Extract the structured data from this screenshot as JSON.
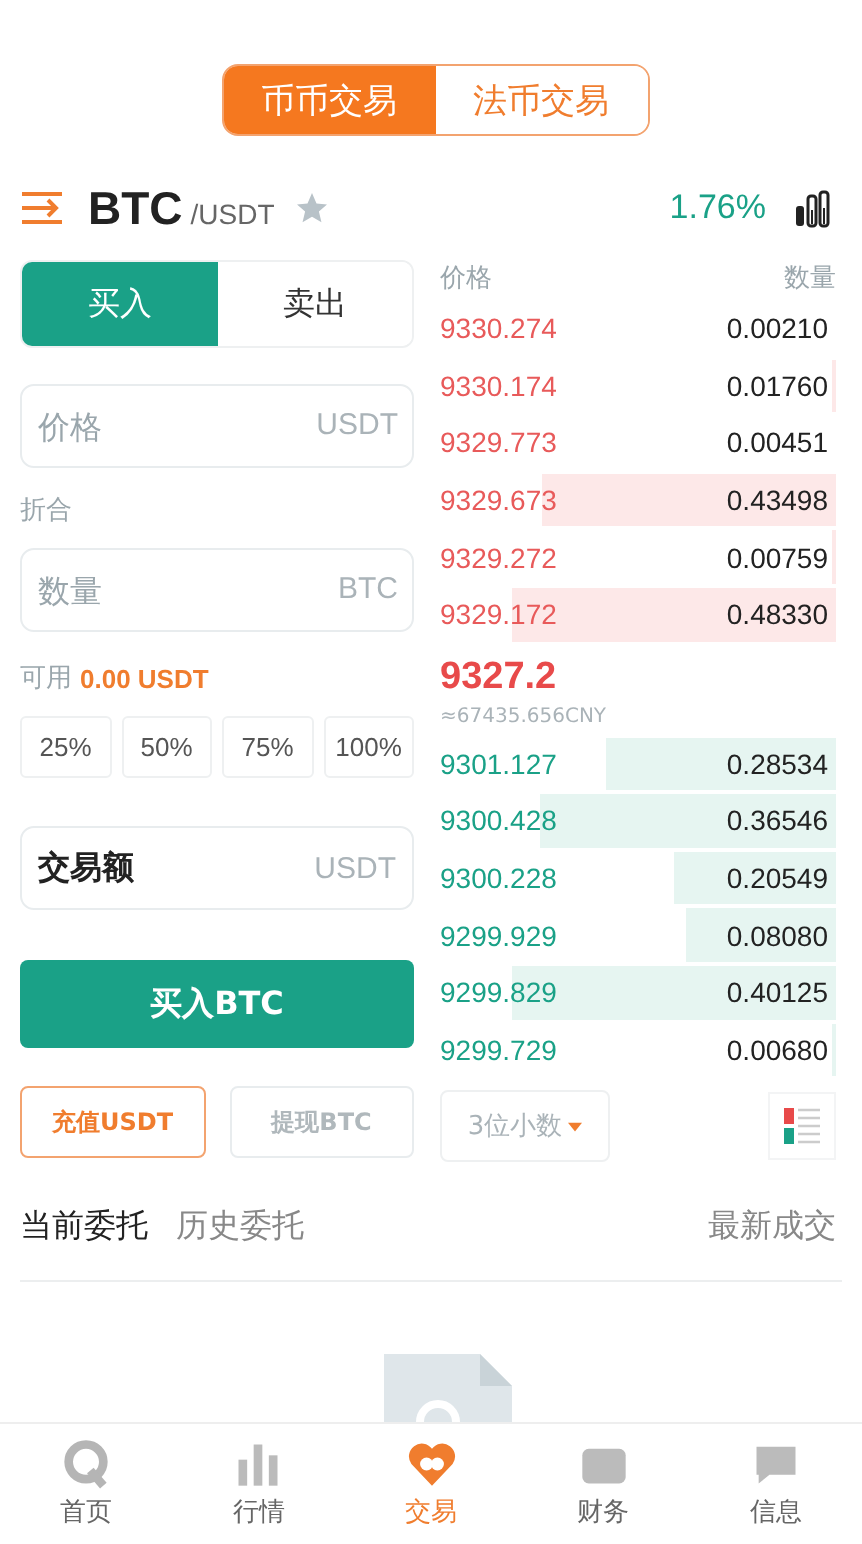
{
  "market_tabs": [
    {
      "label": "币币交易",
      "selected": true
    },
    {
      "label": "法币交易",
      "selected": false
    }
  ],
  "pair": {
    "base": "BTC",
    "quote": "/USDT",
    "favorite": false,
    "change": "1.76%"
  },
  "side_tabs": [
    {
      "label": "买入",
      "selected": true
    },
    {
      "label": "卖出",
      "selected": false
    }
  ],
  "price_field": {
    "placeholder": "价格",
    "unit": "USDT"
  },
  "converted_label": "折合",
  "amount_field": {
    "placeholder": "数量",
    "unit": "BTC"
  },
  "available": {
    "label": "可用",
    "value": "0.00 USDT"
  },
  "percent_buttons": [
    "25%",
    "50%",
    "75%",
    "100%"
  ],
  "total_field": {
    "label": "交易额",
    "unit": "USDT"
  },
  "submit_button": "买入BTC",
  "deposit_button": "充值USDT",
  "withdraw_button": "提现BTC",
  "order_book": {
    "price_header": "价格",
    "amount_header": "数量",
    "asks": [
      {
        "price": "9330.274",
        "amount": "0.00210"
      },
      {
        "price": "9330.174",
        "amount": "0.01760"
      },
      {
        "price": "9329.773",
        "amount": "0.00451"
      },
      {
        "price": "9329.673",
        "amount": "0.43498"
      },
      {
        "price": "9329.272",
        "amount": "0.00759"
      },
      {
        "price": "9329.172",
        "amount": "0.48330"
      }
    ],
    "last_price": "9327.2",
    "last_price_cny": "≈67435.656CNY",
    "bids": [
      {
        "price": "9301.127",
        "amount": "0.28534"
      },
      {
        "price": "9300.428",
        "amount": "0.36546"
      },
      {
        "price": "9300.228",
        "amount": "0.20549"
      },
      {
        "price": "9299.929",
        "amount": "0.08080"
      },
      {
        "price": "9299.829",
        "amount": "0.40125"
      },
      {
        "price": "9299.729",
        "amount": "0.00680"
      }
    ],
    "precision_select": "3位小数"
  },
  "order_tabs": [
    {
      "label": "当前委托",
      "selected": true
    },
    {
      "label": "历史委托",
      "selected": false
    }
  ],
  "latest_trades_link": "最新成交",
  "bottom_nav": [
    {
      "label": "首页",
      "kind": "home",
      "selected": false
    },
    {
      "label": "行情",
      "kind": "market",
      "selected": false
    },
    {
      "label": "交易",
      "kind": "trade",
      "selected": true
    },
    {
      "label": "财务",
      "kind": "finance",
      "selected": false
    },
    {
      "label": "信息",
      "kind": "info",
      "selected": false
    }
  ]
}
